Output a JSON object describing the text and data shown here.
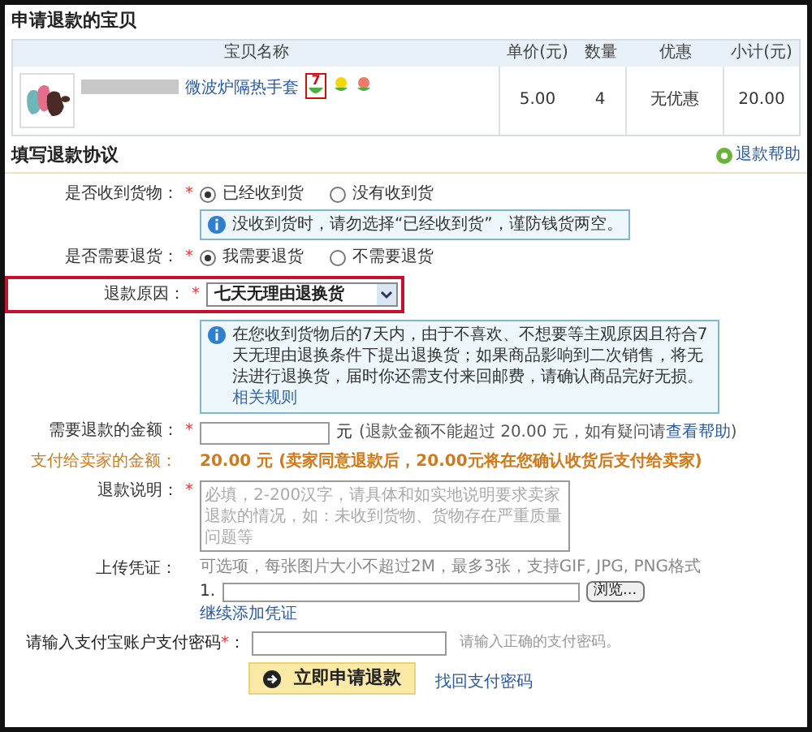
{
  "item_section": {
    "title": "申请退款的宝贝",
    "columns": [
      "宝贝名称",
      "单价(元)",
      "数量",
      "优惠",
      "小计(元)"
    ],
    "rows": [
      {
        "name": "微波炉隔热手套",
        "badge": "7",
        "badge_highlighted": true,
        "price": "5.00",
        "quantity": "4",
        "discount": "无优惠",
        "subtotal": "20.00"
      }
    ]
  },
  "form": {
    "title": "填写退款协议",
    "help_link": "退款帮助",
    "received": {
      "label": "是否收到货物：",
      "required_mark": "*",
      "options": [
        {
          "label": "已经收到货",
          "selected": true
        },
        {
          "label": "没有收到货",
          "selected": false
        }
      ],
      "notice": "没收到货时，请勿选择“已经收到货”，谨防钱货两空。"
    },
    "return_goods": {
      "label": "是否需要退货：",
      "required_mark": "*",
      "options": [
        {
          "label": "我需要退货",
          "selected": true
        },
        {
          "label": "不需要退货",
          "selected": false
        }
      ]
    },
    "reason": {
      "label": "退款原因：",
      "required_mark": "*",
      "value": "七天无理由退换货",
      "highlighted": true,
      "notice": "在您收到货物后的7天内，由于不喜欢、不想要等主观原因且符合7天无理由退换条件下提出退换货；如果商品影响到二次销售，将无法进行退换货，届时你还需支付来回邮费，请确认商品完好无损。",
      "notice_link": "相关规则"
    },
    "amount": {
      "label": "需要退款的金额：",
      "required_mark": "*",
      "unit": "元",
      "hint": "(退款金额不能超过 20.00 元，如有疑问请",
      "hint_link": "查看帮助",
      "hint_end": ")"
    },
    "seller_amount": {
      "label": "支付给卖家的金额：",
      "value": "20.00 元 (卖家同意退款后，20.00元将在您确认收货后支付给卖家)"
    },
    "description": {
      "label": "退款说明：",
      "required_mark": "*",
      "placeholder": "必填，2-200汉字，请具体和如实地说明要求卖家退款的情况，如：未收到货物、货物存在严重质量问题等"
    },
    "upload": {
      "label": "上传凭证：",
      "hint": "可选项，每张图片大小不超过2M，最多3张，支持GIF, JPG, PNG格式",
      "index": "1.",
      "browse": "浏览...",
      "add_link": "继续添加凭证"
    },
    "password": {
      "label": "请输入支付宝账户支付密码",
      "required_mark": "*",
      "colon": "：",
      "hint": "请输入正确的支付密码。"
    },
    "submit": "立即申请退款",
    "recover_link": "找回支付密码"
  }
}
